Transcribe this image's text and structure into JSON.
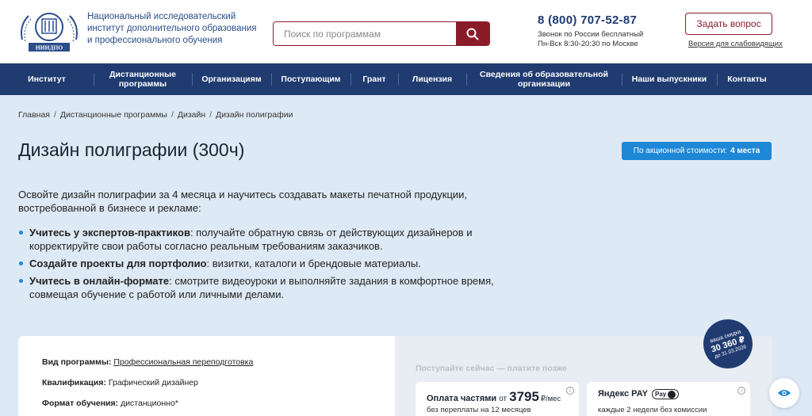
{
  "header": {
    "org_lines": [
      "Национальный исследовательский",
      "институт дополнительного образования",
      "и профессионального обучения"
    ],
    "logo_text": "НИИДПО",
    "search_placeholder": "Поиск по программам",
    "phone": "8 (800) 707-52-87",
    "phone_note_1": "Звонок по России бесплатный",
    "phone_note_2": "Пн-Вск 8:30-20:30 по Москве",
    "ask_label": "Задать вопрос",
    "low_vision_label": "Версия для слабовидящих",
    "brand_color": "#8a1c2a",
    "nav_color": "#1f3b70"
  },
  "nav": {
    "items": [
      {
        "label": "Институт"
      },
      {
        "label": "Дистанционные программы"
      },
      {
        "label": "Организациям"
      },
      {
        "label": "Поступающим"
      },
      {
        "label": "Грант"
      },
      {
        "label": "Лицензия"
      },
      {
        "label": "Сведения об образовательной организации"
      },
      {
        "label": "Наши выпускники"
      },
      {
        "label": "Контакты"
      }
    ]
  },
  "breadcrumb": {
    "items": [
      "Главная",
      "Дистанционные программы",
      "Дизайн",
      "Дизайн полиграфии"
    ]
  },
  "page": {
    "title": "Дизайн полиграфии (300ч)",
    "promo_text": "По акционной стоимости:",
    "promo_count": "4 места",
    "intro": "Освойте дизайн полиграфии за 4 месяца и научитесь создавать макеты печатной продукции, востребованной в бизнесе и рекламе:",
    "bullets": [
      {
        "bold": "Учитесь у экспертов-практиков",
        "text": ": получайте обратную связь от действующих дизайнеров и корректируйте свои работы согласно реальным требованиям заказчиков."
      },
      {
        "bold": "Создайте проекты для портфолио",
        "text": ": визитки, каталоги и брендовые материалы."
      },
      {
        "bold": "Учитесь в онлайн-формате",
        "text": ": смотрите видеоуроки и выполняйте задания в комфортное время, совмещая обучение с работой или личными делами."
      }
    ]
  },
  "program_info": {
    "type_label": "Вид программы:",
    "type_value": "Профессиональная переподготовка",
    "qual_label": "Квалификация:",
    "qual_value": "Графический дизайнер",
    "format_label": "Формат обучения:",
    "format_value": "дистанционно*"
  },
  "payment": {
    "heading": "Поступайте сейчас — платите позже",
    "installment_title": "Оплата частями",
    "installment_from": "от",
    "installment_price": "3795",
    "installment_unit": "₽/мес",
    "installment_sub": "без переплаты на 12 месяцев",
    "yandex_title": "Яндекс PAY",
    "yandex_badge": "Pay",
    "yandex_sub": "каждые 2 недели без комиссии"
  },
  "discount": {
    "line1": "ваша скидка",
    "line2": "30 360 ₽",
    "line3": "до 31.03.2026"
  }
}
